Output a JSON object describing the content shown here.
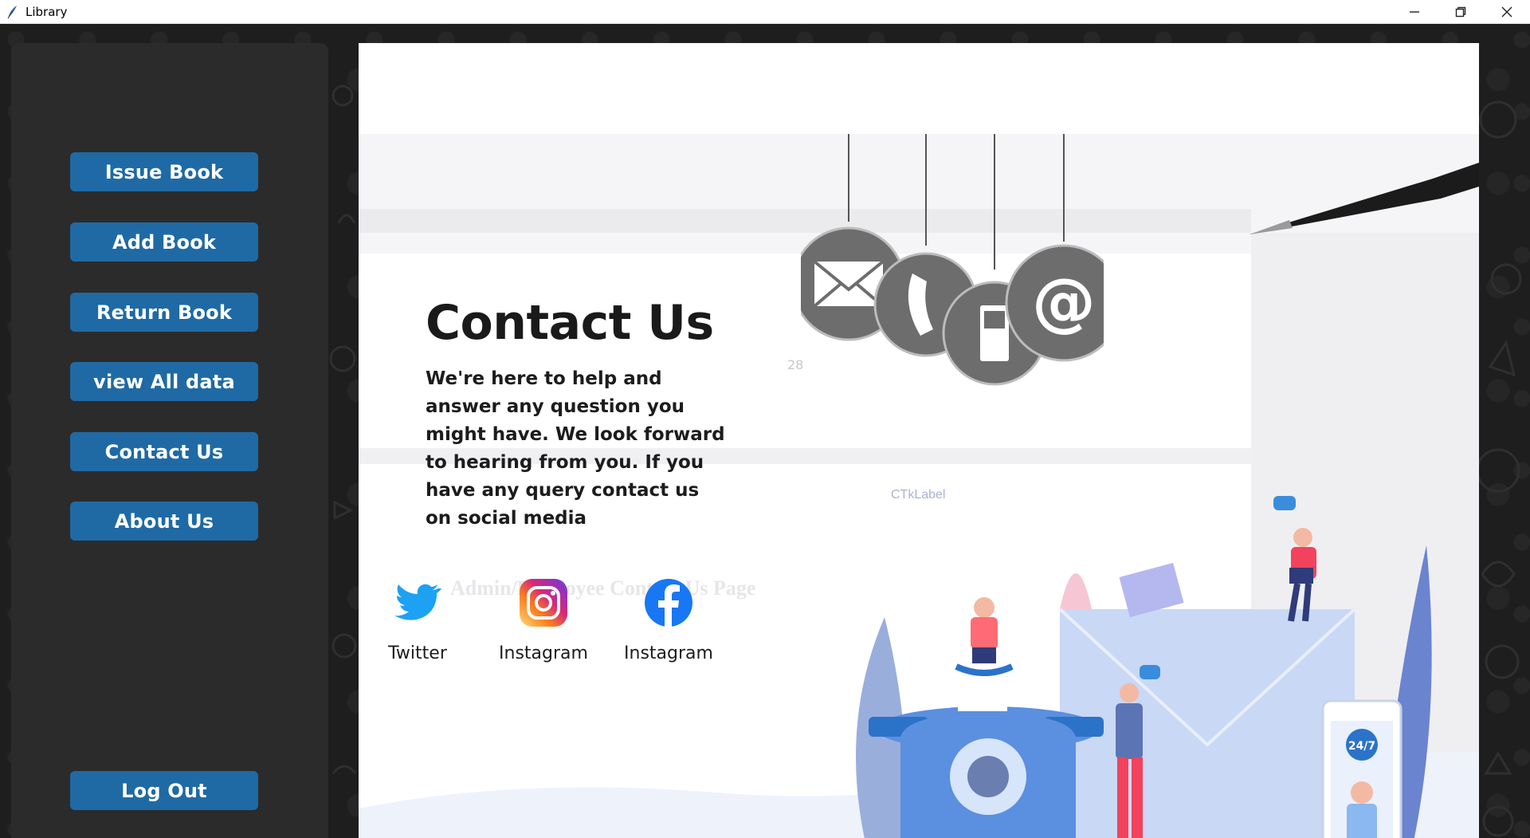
{
  "window": {
    "title": "Library"
  },
  "sidebar": {
    "buttons": [
      {
        "label": "Issue Book"
      },
      {
        "label": "Add Book"
      },
      {
        "label": "Return Book"
      },
      {
        "label": "view All data"
      },
      {
        "label": "Contact Us"
      },
      {
        "label": "About Us"
      }
    ],
    "logout_label": "Log Out"
  },
  "main": {
    "heading": "Contact Us",
    "body": "We're here to help and answer any question you might have. We look forward to hearing from you. If you have any query contact us on social media",
    "ctk_label": "CTkLabel",
    "watermark": "Admin/Employee Contact Us Page",
    "ghost_page_number": "28",
    "social": [
      {
        "label": "Twitter",
        "icon": "twitter-icon"
      },
      {
        "label": "Instagram",
        "icon": "instagram-icon"
      },
      {
        "label": "Instagram",
        "icon": "facebook-icon"
      }
    ]
  },
  "colors": {
    "accent": "#1f6aa5",
    "sidebar_bg": "#2b2b2b",
    "window_bg": "#1e1e1e"
  }
}
